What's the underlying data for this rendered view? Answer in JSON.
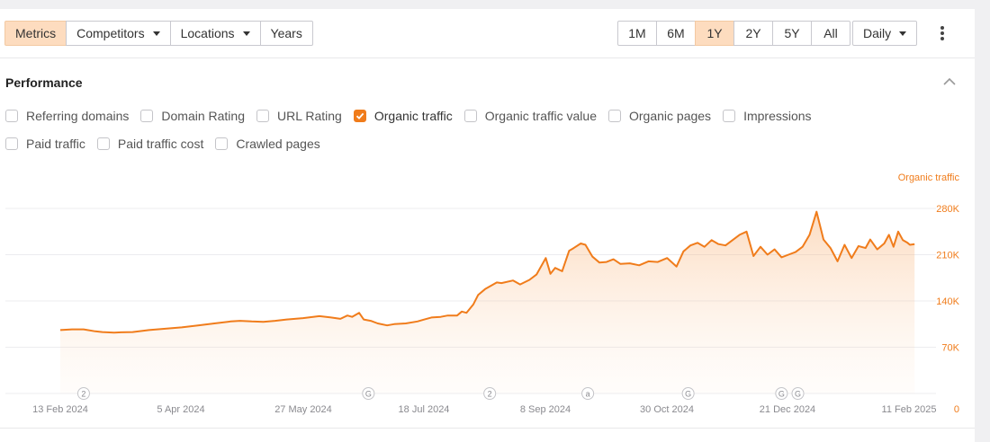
{
  "toolbar": {
    "tabs": [
      {
        "label": "Metrics",
        "active": true,
        "dropdown": false
      },
      {
        "label": "Competitors",
        "active": false,
        "dropdown": true
      },
      {
        "label": "Locations",
        "active": false,
        "dropdown": true
      },
      {
        "label": "Years",
        "active": false,
        "dropdown": false
      }
    ],
    "ranges": [
      {
        "label": "1M",
        "active": false
      },
      {
        "label": "6M",
        "active": false
      },
      {
        "label": "1Y",
        "active": true
      },
      {
        "label": "2Y",
        "active": false
      },
      {
        "label": "5Y",
        "active": false
      },
      {
        "label": "All",
        "active": false
      }
    ],
    "granularity": "Daily",
    "more_icon": "more-vertical-icon"
  },
  "performance": {
    "title": "Performance",
    "collapse_icon": "chevron-up-icon",
    "metrics_row1": [
      {
        "label": "Referring domains",
        "checked": false
      },
      {
        "label": "Domain Rating",
        "checked": false
      },
      {
        "label": "URL Rating",
        "checked": false
      },
      {
        "label": "Organic traffic",
        "checked": true
      },
      {
        "label": "Organic traffic value",
        "checked": false
      },
      {
        "label": "Organic pages",
        "checked": false
      },
      {
        "label": "Impressions",
        "checked": false
      }
    ],
    "metrics_row2": [
      {
        "label": "Paid traffic",
        "checked": false
      },
      {
        "label": "Paid traffic cost",
        "checked": false
      },
      {
        "label": "Crawled pages",
        "checked": false
      }
    ]
  },
  "colors": {
    "accent": "#f07c1b",
    "active_bg": "#fddcbf"
  },
  "chart_data": {
    "type": "area",
    "series": [
      {
        "name": "Organic traffic",
        "x": [
          "2024-02-13",
          "2024-02-18",
          "2024-02-23",
          "2024-02-28",
          "2024-03-02",
          "2024-03-07",
          "2024-03-10",
          "2024-03-15",
          "2024-03-22",
          "2024-03-29",
          "2024-04-05",
          "2024-04-12",
          "2024-04-19",
          "2024-04-26",
          "2024-04-30",
          "2024-05-05",
          "2024-05-10",
          "2024-05-15",
          "2024-05-20",
          "2024-05-27",
          "2024-06-03",
          "2024-06-08",
          "2024-06-12",
          "2024-06-15",
          "2024-06-17",
          "2024-06-20",
          "2024-06-22",
          "2024-06-25",
          "2024-06-28",
          "2024-07-02",
          "2024-07-05",
          "2024-07-10",
          "2024-07-15",
          "2024-07-18",
          "2024-07-21",
          "2024-07-25",
          "2024-07-28",
          "2024-08-01",
          "2024-08-03",
          "2024-08-05",
          "2024-08-08",
          "2024-08-10",
          "2024-08-13",
          "2024-08-18",
          "2024-08-20",
          "2024-08-25",
          "2024-08-28",
          "2024-09-01",
          "2024-09-04",
          "2024-09-08",
          "2024-09-10",
          "2024-09-12",
          "2024-09-15",
          "2024-09-18",
          "2024-09-20",
          "2024-09-23",
          "2024-09-25",
          "2024-09-28",
          "2024-10-01",
          "2024-10-04",
          "2024-10-07",
          "2024-10-10",
          "2024-10-14",
          "2024-10-18",
          "2024-10-22",
          "2024-10-26",
          "2024-10-30",
          "2024-11-03",
          "2024-11-06",
          "2024-11-09",
          "2024-11-12",
          "2024-11-15",
          "2024-11-18",
          "2024-11-21",
          "2024-11-24",
          "2024-11-27",
          "2024-11-30",
          "2024-12-03",
          "2024-12-06",
          "2024-12-09",
          "2024-12-12",
          "2024-12-15",
          "2024-12-18",
          "2024-12-21",
          "2024-12-24",
          "2024-12-27",
          "2024-12-30",
          "2025-01-02",
          "2025-01-05",
          "2025-01-08",
          "2025-01-11",
          "2025-01-14",
          "2025-01-17",
          "2025-01-20",
          "2025-01-23",
          "2025-01-25",
          "2025-01-28",
          "2025-01-31",
          "2025-02-02",
          "2025-02-04",
          "2025-02-06",
          "2025-02-08",
          "2025-02-10",
          "2025-02-11",
          "2025-02-13"
        ],
        "values": [
          96000,
          97000,
          97000,
          94000,
          93000,
          92000,
          92500,
          93000,
          96000,
          98000,
          100000,
          103000,
          106000,
          109000,
          110000,
          109000,
          108500,
          110000,
          112000,
          114000,
          117000,
          115000,
          113000,
          118000,
          116000,
          122000,
          112000,
          110000,
          106000,
          103000,
          105000,
          106000,
          109000,
          112000,
          115000,
          116000,
          118000,
          118000,
          124000,
          122000,
          135000,
          149000,
          158000,
          168000,
          167000,
          171000,
          165000,
          172000,
          180000,
          205000,
          181000,
          190000,
          185000,
          216000,
          220000,
          227000,
          225000,
          207000,
          198000,
          199000,
          203000,
          196000,
          197000,
          194000,
          200000,
          199000,
          205000,
          192000,
          215000,
          224000,
          228000,
          222000,
          232000,
          226000,
          224000,
          232000,
          240000,
          245000,
          208000,
          222000,
          210000,
          218000,
          206000,
          210000,
          214000,
          222000,
          240000,
          275000,
          233000,
          220000,
          200000,
          225000,
          205000,
          223000,
          220000,
          233000,
          218000,
          227000,
          240000,
          222000,
          245000,
          232000,
          228000,
          225000,
          226000
        ]
      }
    ],
    "x_ticks": [
      "13 Feb 2024",
      "5 Apr 2024",
      "27 May 2024",
      "18 Jul 2024",
      "8 Sep 2024",
      "30 Oct 2024",
      "21 Dec 2024",
      "11 Feb 2025"
    ],
    "y_ticks": [
      "0",
      "70K",
      "140K",
      "210K",
      "280K"
    ],
    "ylim": [
      0,
      280000
    ],
    "ylabel": "Organic traffic",
    "annotations": [
      {
        "date": "2024-02-23",
        "label": "2"
      },
      {
        "date": "2024-06-24",
        "label": "G"
      },
      {
        "date": "2024-08-15",
        "label": "2"
      },
      {
        "date": "2024-09-26",
        "label": "a"
      },
      {
        "date": "2024-11-08",
        "label": "G"
      },
      {
        "date": "2024-12-18",
        "label": "G"
      },
      {
        "date": "2024-12-25",
        "label": "G"
      }
    ],
    "grid": true
  }
}
